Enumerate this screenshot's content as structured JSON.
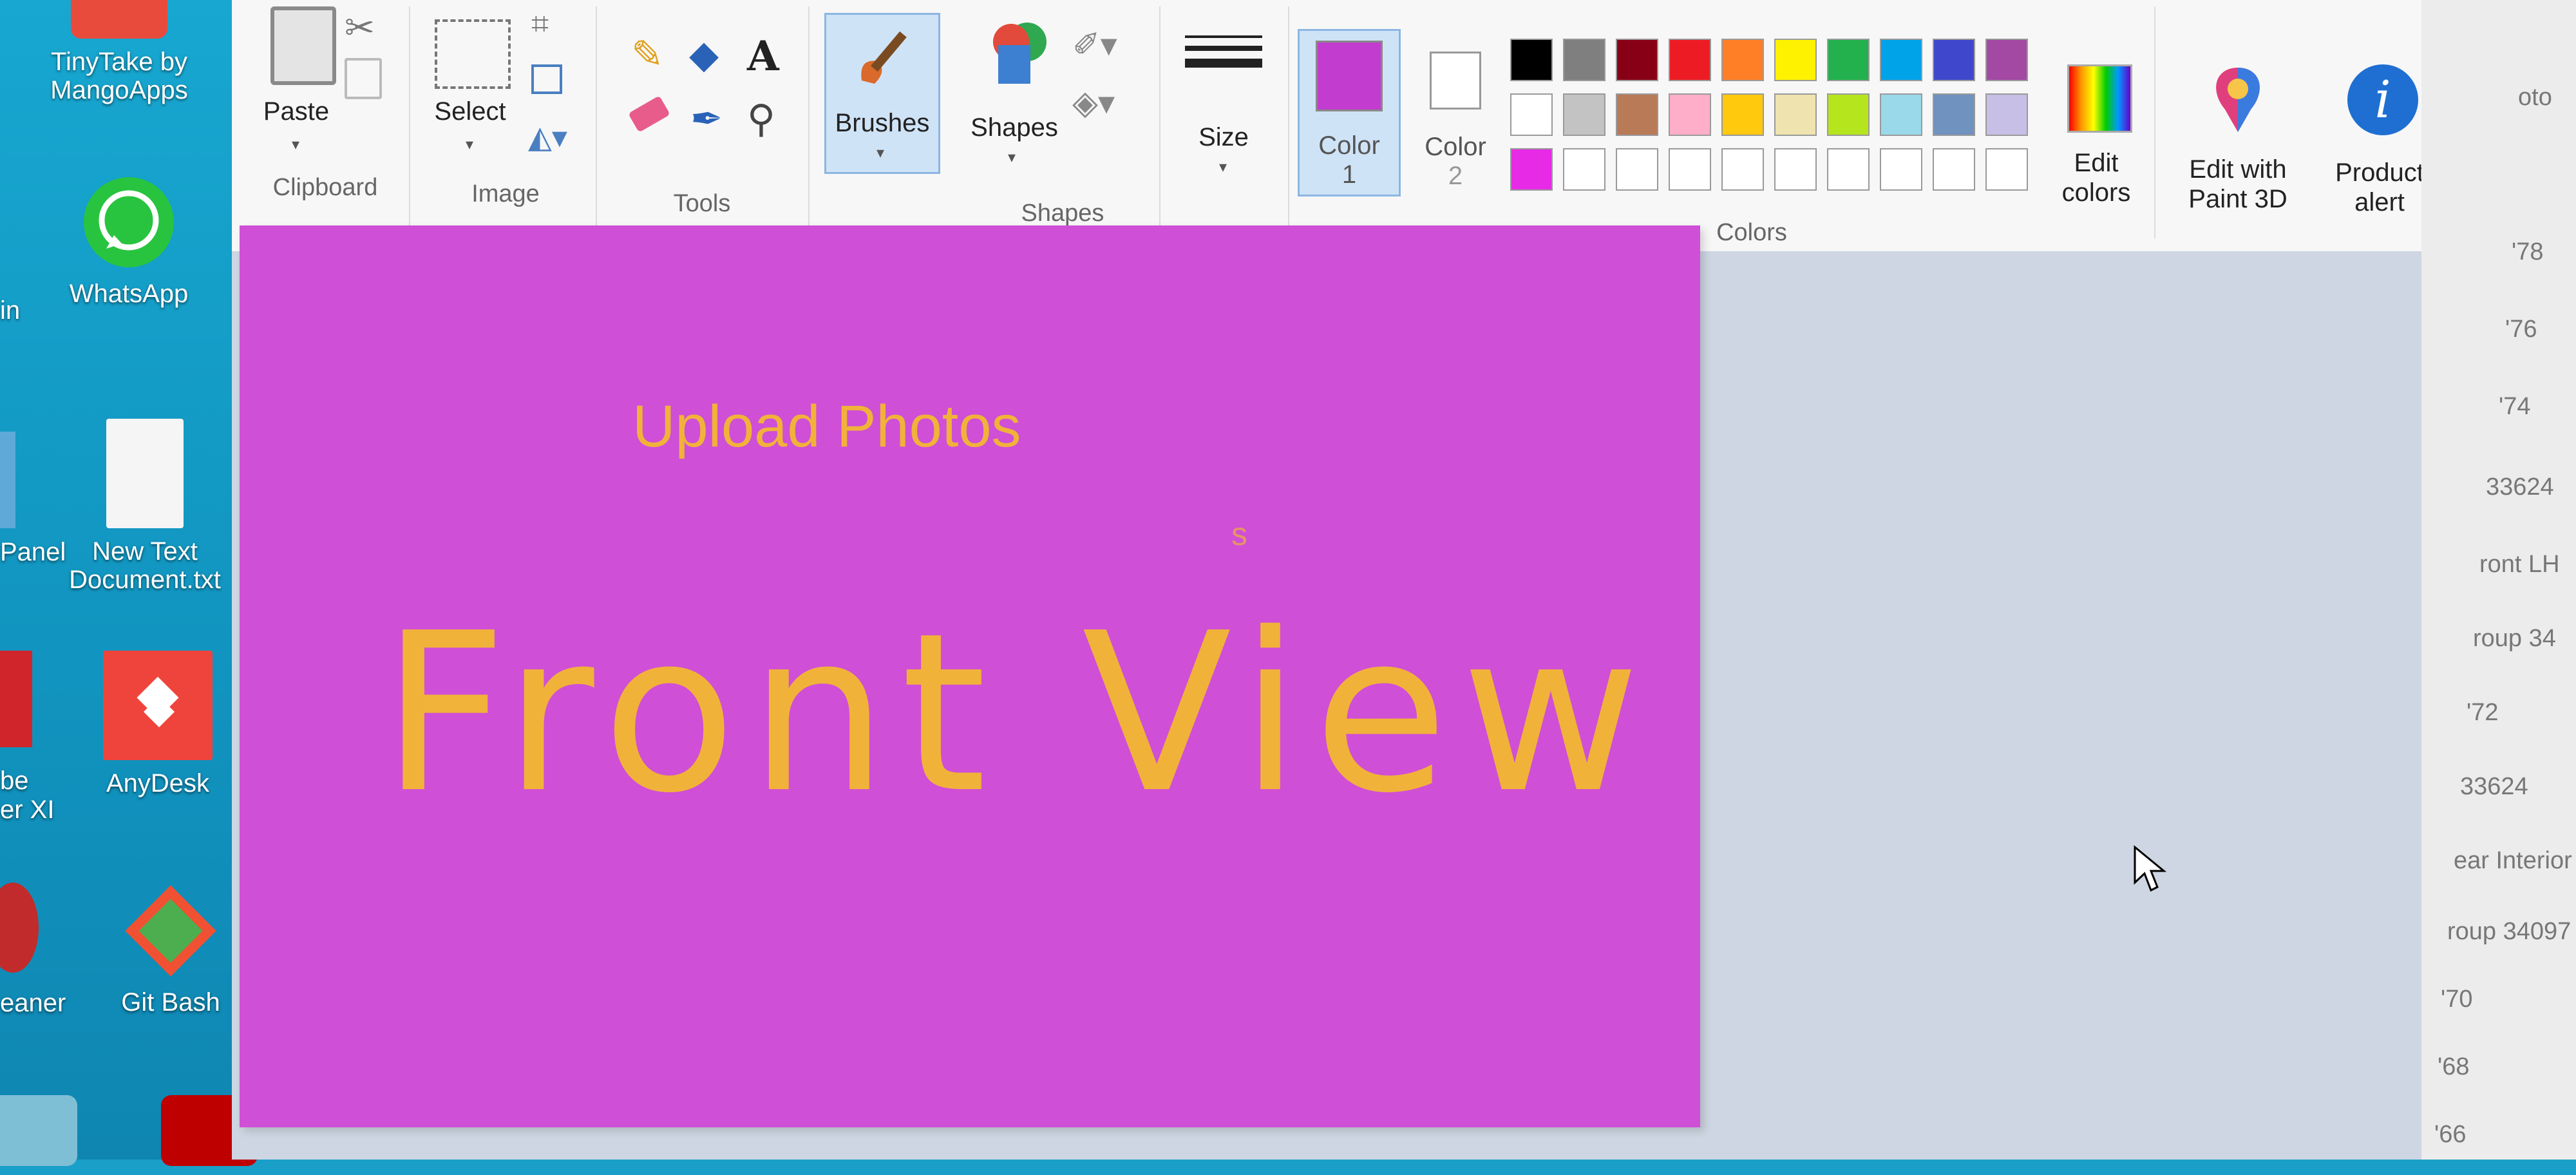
{
  "desktop": {
    "icons": [
      {
        "label_line1": "TinyTake by",
        "label_line2": "MangoApps"
      },
      {
        "label_line1": "WhatsApp",
        "label_line2": ""
      },
      {
        "label_line1": "New Text",
        "label_line2": "Document.txt"
      },
      {
        "label_line1": "AnyDesk",
        "label_line2": ""
      },
      {
        "label_line1": "Git Bash",
        "label_line2": ""
      }
    ],
    "edge_labels": [
      "in",
      "Panel",
      "be",
      "er XI",
      "eaner"
    ]
  },
  "ribbon": {
    "clipboard": {
      "paste_label": "Paste",
      "group_label": "Clipboard"
    },
    "image": {
      "select_label": "Select",
      "group_label": "Image"
    },
    "tools": {
      "group_label": "Tools"
    },
    "brushes_label": "Brushes",
    "shapes": {
      "shapes_label": "Shapes",
      "group_label": "Shapes"
    },
    "size_label": "Size",
    "color1": {
      "line1": "Color",
      "line2": "1",
      "value": "#c23ccf"
    },
    "color2": {
      "line1": "Color",
      "line2": "2",
      "value": "#ffffff"
    },
    "colors_group_label": "Colors",
    "edit_colors": {
      "line1": "Edit",
      "line2": "colors"
    },
    "edit_paint3d": {
      "line1": "Edit with",
      "line2": "Paint 3D"
    },
    "product_alert": {
      "line1": "Product",
      "line2": "alert"
    },
    "palette_row1": [
      "#000000",
      "#7f7f7f",
      "#880015",
      "#ed1c24",
      "#ff7f27",
      "#fff200",
      "#22b14c",
      "#00a2e8",
      "#3f48cc",
      "#a349a4"
    ],
    "palette_row2": [
      "#ffffff",
      "#c3c3c3",
      "#b97a57",
      "#ffaec9",
      "#ffc90e",
      "#efe4b0",
      "#b5e61d",
      "#99d9ea",
      "#7092be",
      "#c8bfe7"
    ],
    "palette_row3": [
      "#e62ae6",
      "#ffffff",
      "#ffffff",
      "#ffffff",
      "#ffffff",
      "#ffffff",
      "#ffffff",
      "#ffffff",
      "#ffffff",
      "#ffffff"
    ]
  },
  "canvas": {
    "background": "#cf4fd6",
    "text_color": "#f1b23a",
    "small_text": "Upload Photos",
    "large_text": "Front View",
    "stray_char": "s"
  },
  "right_list": [
    "oto",
    "'78",
    "'76",
    "'74",
    "33624",
    "ront LH",
    "roup 34",
    "'72",
    "33624",
    "ear Interior",
    "roup 34097",
    "'70",
    "'68",
    "'66"
  ]
}
